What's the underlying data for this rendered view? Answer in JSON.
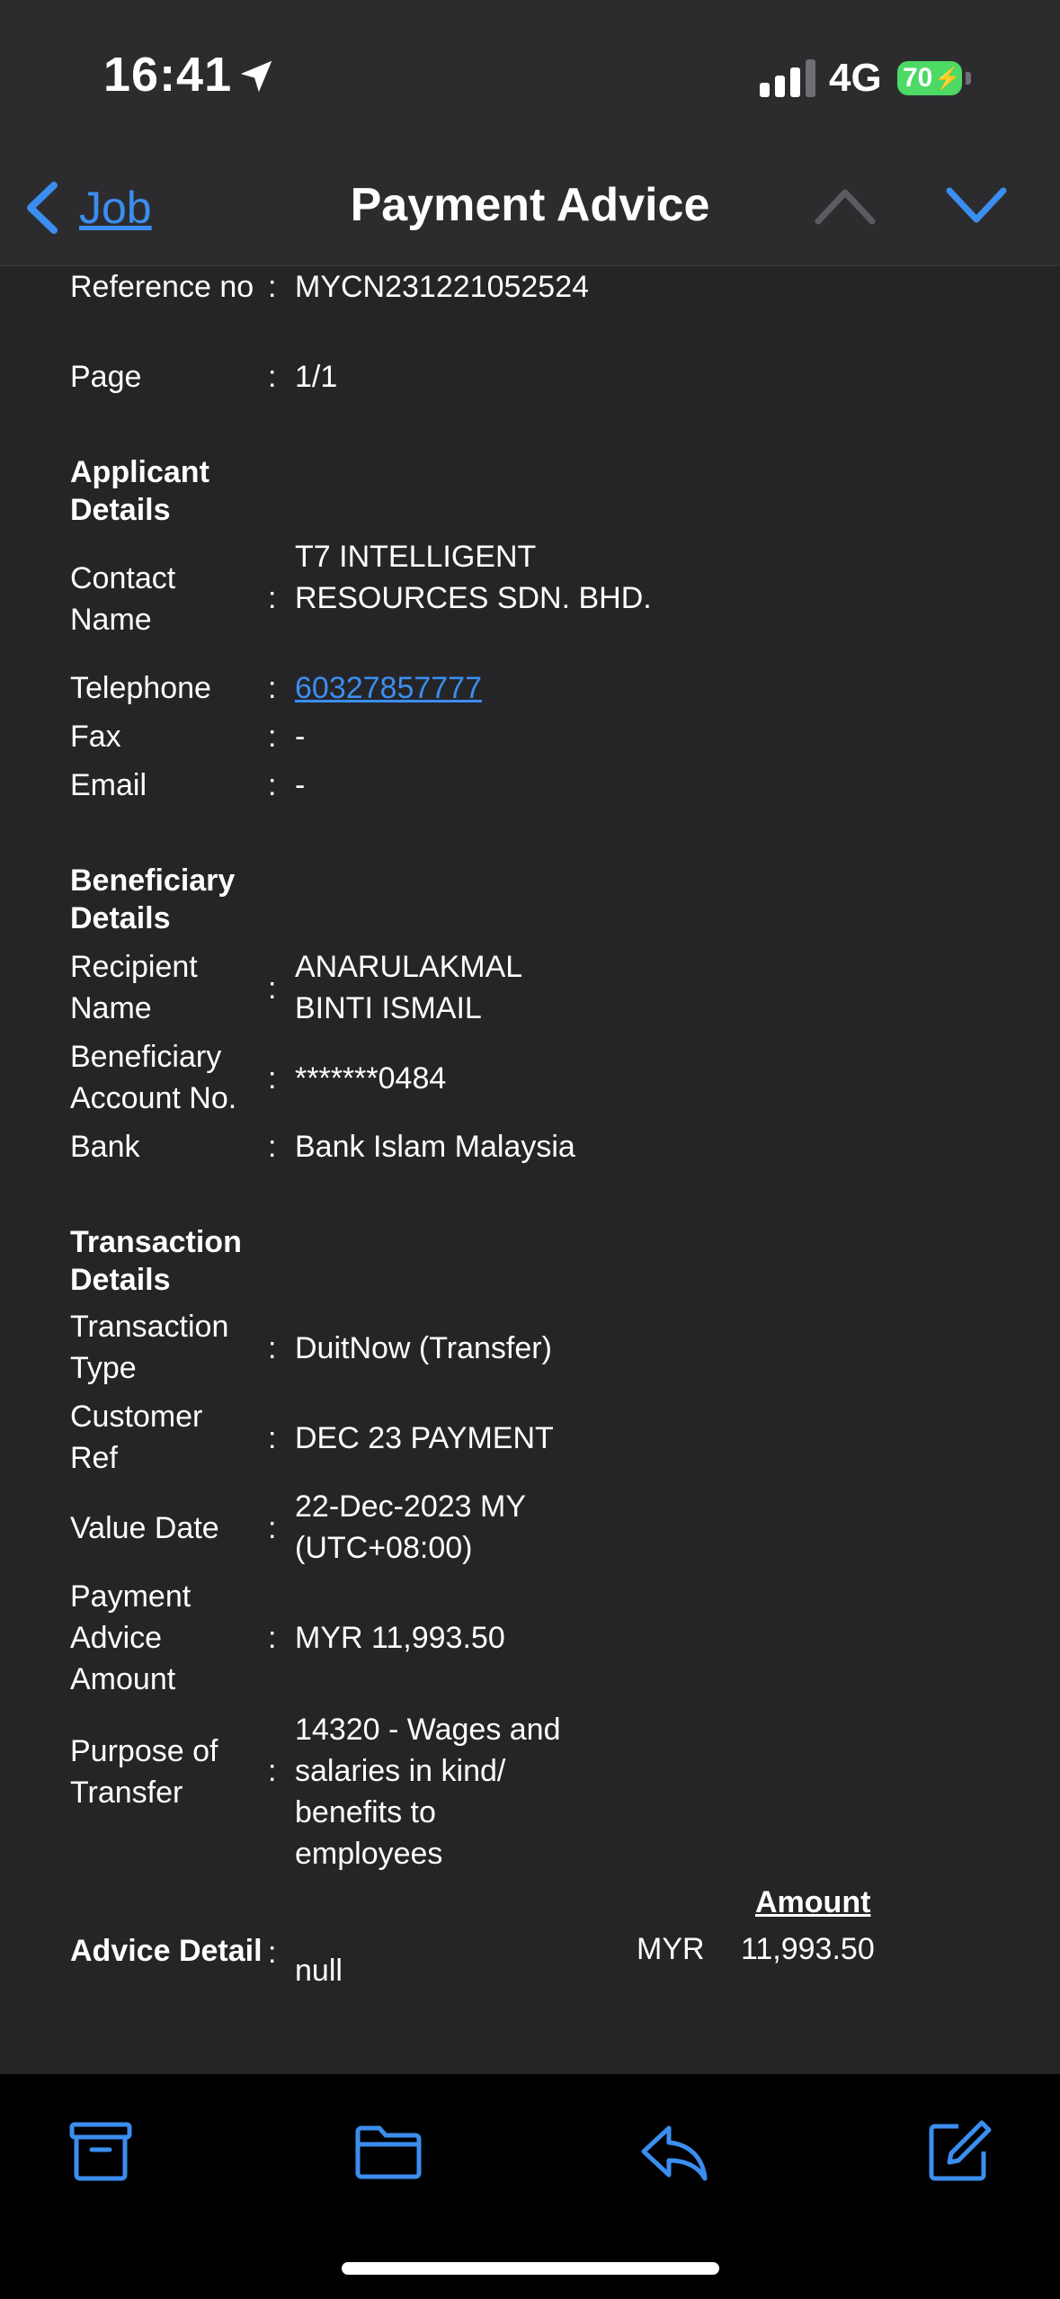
{
  "status_bar": {
    "time": "16:41",
    "network": "4G",
    "battery_level": "70",
    "icons": [
      "location-arrow-icon",
      "signal-bars-icon",
      "battery-charging-icon"
    ]
  },
  "nav": {
    "back_label": "Job",
    "title": "Payment Advice",
    "accent_color": "#3b8ef0",
    "icons": [
      "chevron-left-icon",
      "chevron-up-icon",
      "chevron-down-icon"
    ]
  },
  "document": {
    "header_fields": [
      {
        "label": "Reference no",
        "value": "MYCN231221052524"
      },
      {
        "label": "Page",
        "value": "1/1"
      }
    ],
    "applicant": {
      "title": "Applicant Details",
      "contact_name_label": "Contact Name",
      "contact_name": "T7 INTELLIGENT RESOURCES SDN. BHD.",
      "telephone_label": "Telephone",
      "telephone": "60327857777",
      "fax_label": "Fax",
      "fax": "-",
      "email_label": "Email",
      "email": "-"
    },
    "beneficiary": {
      "title": "Beneficiary Details",
      "recipient_label": "Recipient Name",
      "recipient": "ANARULAKMAL BINTI ISMAIL",
      "account_label": "Beneficiary Account No.",
      "account": "*******0484",
      "bank_label": "Bank",
      "bank": "Bank Islam Malaysia"
    },
    "transaction": {
      "title": "Transaction Details",
      "type_label": "Transaction Type",
      "type": "DuitNow (Transfer)",
      "customer_ref_label": "Customer Ref",
      "customer_ref": "DEC 23 PAYMENT",
      "value_date_label": "Value Date",
      "value_date": "22-Dec-2023 MY (UTC+08:00)",
      "amount_label": "Payment Advice Amount",
      "amount": "MYR 11,993.50",
      "purpose_label": "Purpose of Transfer",
      "purpose": "14320 - Wages and salaries in kind/ benefits to employees"
    },
    "advice": {
      "amount_header": "Amount",
      "label": "Advice Detail",
      "value": "null",
      "currency": "MYR",
      "amount": "11,993.50"
    },
    "separator": ":"
  },
  "toolbar": {
    "icons": [
      "archive-icon",
      "folder-icon",
      "reply-icon",
      "compose-icon"
    ]
  }
}
